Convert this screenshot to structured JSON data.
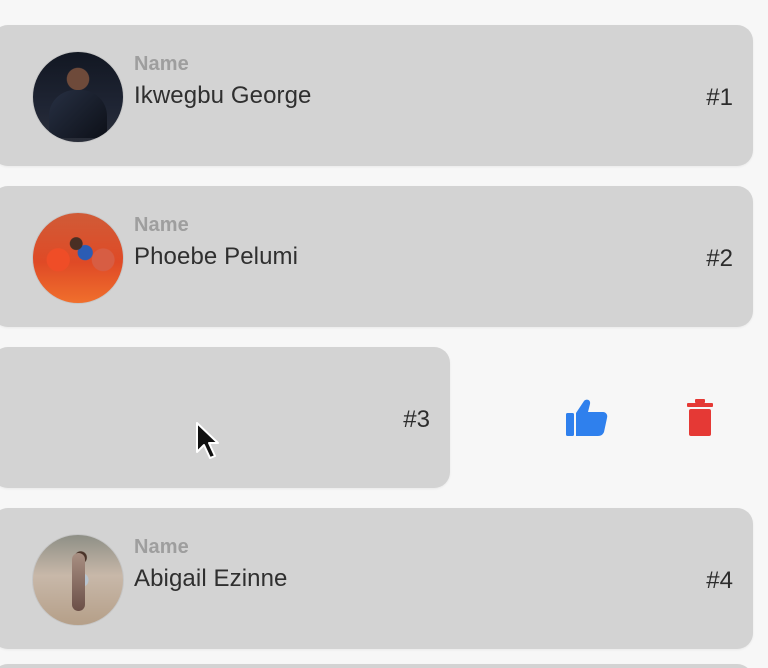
{
  "list": {
    "items": [
      {
        "name_label": "Name",
        "name": "Ikwegbu George",
        "rank": "#1",
        "avatar_icon": "profile-photo-icon"
      },
      {
        "name_label": "Name",
        "name": "Phoebe Pelumi",
        "rank": "#2",
        "avatar_icon": "profile-photo-icon"
      },
      {
        "name_label": "",
        "name": "",
        "rank": "#3",
        "avatar_icon": ""
      },
      {
        "name_label": "Name",
        "name": "Abigail Ezinne",
        "rank": "#4",
        "avatar_icon": "profile-photo-icon"
      }
    ]
  },
  "actions": {
    "like_icon": "thumbs-up-icon",
    "delete_icon": "trash-icon"
  },
  "colors": {
    "background": "#f7f7f7",
    "card": "#d3d3d3",
    "label": "#9e9e9e",
    "text": "#2f2f2f",
    "like": "#2f80ed",
    "delete": "#e53935"
  }
}
